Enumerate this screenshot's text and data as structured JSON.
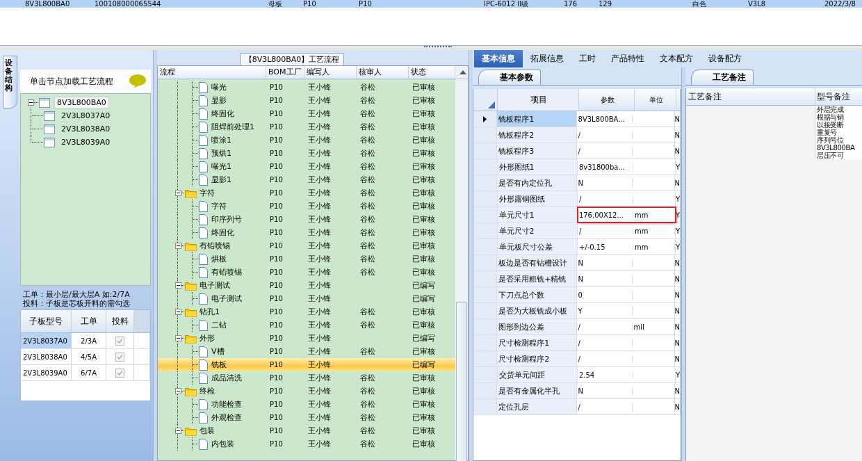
{
  "top_grid": {
    "row": {
      "selected": true,
      "cells": [
        "8V3L800BA0",
        "100108000065544",
        "母板",
        "P10",
        "P10",
        "IPC-6012 II级",
        "176",
        "129",
        "白色",
        "V3L8",
        "2022/3/8"
      ]
    }
  },
  "left_panel": {
    "side_tab": "设备结构",
    "hint": "单击节点加载工艺流程",
    "tree": {
      "label": "8V3L800BA0",
      "expanded": true,
      "selected": true,
      "children": [
        {
          "label": "2V3L8037A0",
          "selected": false
        },
        {
          "label": "2V3L8038A0",
          "selected": false
        },
        {
          "label": "2V3L8039A0",
          "selected": false
        }
      ]
    },
    "notes": [
      "工单：最小层/最大层A 如:2/7A",
      "投料：子板是芯板开料的需勾选"
    ],
    "grid": {
      "columns": [
        "子板型号",
        "工单",
        "投料"
      ],
      "rows": [
        {
          "model": "2V3L8037A0",
          "order": "2/3A",
          "feed": true,
          "selected": true
        },
        {
          "model": "2V3L8038A0",
          "order": "4/5A",
          "feed": true,
          "selected": false
        },
        {
          "model": "2V3L8039A0",
          "order": "6/7A",
          "feed": true,
          "selected": false
        }
      ]
    }
  },
  "process_panel": {
    "title": "【8V3L800BA0】工艺流程",
    "columns": [
      "流程",
      "BOM工厂",
      "编写人",
      "核审人",
      "状态"
    ],
    "scrolled_group_children": [
      {
        "label": "曝光",
        "factory": "P10",
        "writer": "王小锋",
        "reviewer": "谷松",
        "status": "已审核",
        "selected": false
      },
      {
        "label": "显影",
        "factory": "P10",
        "writer": "王小锋",
        "reviewer": "谷松",
        "status": "已审核",
        "selected": false
      },
      {
        "label": "终固化",
        "factory": "P10",
        "writer": "王小锋",
        "reviewer": "谷松",
        "status": "已审核",
        "selected": false
      },
      {
        "label": "阻焊前处理1",
        "factory": "P10",
        "writer": "王小锋",
        "reviewer": "谷松",
        "status": "已审核",
        "selected": false
      },
      {
        "label": "喷涂1",
        "factory": "P10",
        "writer": "王小锋",
        "reviewer": "谷松",
        "status": "已审核",
        "selected": false
      },
      {
        "label": "预烘1",
        "factory": "P10",
        "writer": "王小锋",
        "reviewer": "谷松",
        "status": "已审核",
        "selected": false
      },
      {
        "label": "曝光1",
        "factory": "P10",
        "writer": "王小锋",
        "reviewer": "谷松",
        "status": "已审核",
        "selected": false
      },
      {
        "label": "显影1",
        "factory": "P10",
        "writer": "王小锋",
        "reviewer": "谷松",
        "status": "已审核",
        "selected": false
      }
    ],
    "groups": [
      {
        "label": "字符",
        "factory": "P10",
        "writer": "王小锋",
        "reviewer": "谷松",
        "status": "已审核",
        "expanded": true,
        "children": [
          {
            "label": "字符",
            "factory": "P10",
            "writer": "王小锋",
            "reviewer": "谷松",
            "status": "已审核",
            "selected": false
          },
          {
            "label": "印序列号",
            "factory": "P10",
            "writer": "王小锋",
            "reviewer": "谷松",
            "status": "已审核",
            "selected": false
          },
          {
            "label": "终固化",
            "factory": "P10",
            "writer": "王小锋",
            "reviewer": "谷松",
            "status": "已审核",
            "selected": false
          }
        ]
      },
      {
        "label": "有铅喷锡",
        "factory": "P10",
        "writer": "王小锋",
        "reviewer": "谷松",
        "status": "已审核",
        "expanded": true,
        "children": [
          {
            "label": "烘板",
            "factory": "P10",
            "writer": "王小锋",
            "reviewer": "谷松",
            "status": "已审核",
            "selected": false
          },
          {
            "label": "有铅喷锡",
            "factory": "P10",
            "writer": "王小锋",
            "reviewer": "谷松",
            "status": "已审核",
            "selected": false
          }
        ]
      },
      {
        "label": "电子测试",
        "factory": "P10",
        "writer": "王小锋",
        "status": "已编写",
        "expanded": true,
        "children": [
          {
            "label": "电子测试",
            "factory": "P10",
            "writer": "王小锋",
            "status": "已编写",
            "selected": false
          }
        ]
      },
      {
        "label": "钻孔1",
        "factory": "P10",
        "writer": "王小锋",
        "reviewer": "谷松",
        "status": "已审核",
        "expanded": true,
        "children": [
          {
            "label": "二钻",
            "factory": "P10",
            "writer": "王小锋",
            "reviewer": "谷松",
            "status": "已审核",
            "selected": false
          }
        ]
      },
      {
        "label": "外形",
        "factory": "P10",
        "writer": "王小锋",
        "status": "已编写",
        "expanded": true,
        "children": [
          {
            "label": "V槽",
            "factory": "P10",
            "writer": "王小锋",
            "reviewer": "谷松",
            "status": "已审核",
            "selected": false
          },
          {
            "label": "铣板",
            "factory": "P10",
            "writer": "王小锋",
            "status": "已编写",
            "selected": true
          },
          {
            "label": "成品清洗",
            "factory": "P10",
            "writer": "王小锋",
            "reviewer": "谷松",
            "status": "已审核",
            "selected": false
          }
        ]
      },
      {
        "label": "终检",
        "factory": "P10",
        "writer": "王小锋",
        "reviewer": "谷松",
        "status": "已审核",
        "expanded": true,
        "children": [
          {
            "label": "功能检查",
            "factory": "P10",
            "writer": "王小锋",
            "reviewer": "谷松",
            "status": "已审核",
            "selected": false
          },
          {
            "label": "外观检查",
            "factory": "P10",
            "writer": "王小锋",
            "reviewer": "谷松",
            "status": "已审核",
            "selected": false
          }
        ]
      },
      {
        "label": "包装",
        "factory": "P10",
        "writer": "王小锋",
        "reviewer": "谷松",
        "status": "已审核",
        "expanded": true,
        "children": [
          {
            "label": "内包装",
            "factory": "P10",
            "writer": "王小锋",
            "reviewer": "谷松",
            "status": "已审核",
            "selected": false
          }
        ]
      }
    ]
  },
  "detail_panel": {
    "tabs": [
      {
        "label": "基本信息",
        "selected": true
      },
      {
        "label": "拓展信息",
        "selected": false
      },
      {
        "label": "工时",
        "selected": false
      },
      {
        "label": "产品特性",
        "selected": false
      },
      {
        "label": "文本配方",
        "selected": false
      },
      {
        "label": "设备配方",
        "selected": false
      }
    ],
    "sub_tab": "基本参数",
    "columns": [
      "项目",
      "参数",
      "单位"
    ],
    "rows": [
      {
        "item": "铣板程序1",
        "value": "8V3L800BA...",
        "column_4": "N",
        "selected": true,
        "marked": false
      },
      {
        "item": "铣板程序2",
        "value": "/",
        "column_4": "N",
        "selected": false,
        "marked": false
      },
      {
        "item": "铣板程序3",
        "value": "/",
        "column_4": "N",
        "selected": false,
        "marked": false
      },
      {
        "item": "外形图纸1",
        "value": "8v31800ba...",
        "column_4": "Y",
        "selected": false,
        "marked": false
      },
      {
        "item": "是否有内定位孔",
        "value": "N",
        "column_4": "N",
        "selected": false,
        "marked": false
      },
      {
        "item": "外形露铜图纸",
        "value": "/",
        "column_4": "Y",
        "selected": false,
        "marked": false
      },
      {
        "item": "单元尺寸1",
        "value": "176.00X12...",
        "unit": "mm",
        "column_4": "Y",
        "selected": false,
        "marked": true
      },
      {
        "item": "单元尺寸2",
        "value": "/",
        "unit": "mm",
        "column_4": "Y",
        "selected": false,
        "marked": false
      },
      {
        "item": "单元板尺寸公差",
        "value": "+/-0.15",
        "unit": "mm",
        "column_4": "Y",
        "selected": false,
        "marked": false
      },
      {
        "item": "板边是否有钻槽设计",
        "value": "N",
        "column_4": "N",
        "selected": false,
        "marked": false
      },
      {
        "item": "是否采用粗铣+精铣",
        "value": "N",
        "column_4": "N",
        "selected": false,
        "marked": false
      },
      {
        "item": "下刀点总个数",
        "value": "0",
        "column_4": "N",
        "selected": false,
        "marked": false
      },
      {
        "item": "是否为大板铣成小板",
        "value": "Y",
        "column_4": "N",
        "selected": false,
        "marked": false
      },
      {
        "item": "图形到边公差",
        "value": "/",
        "unit": "mil",
        "column_4": "N",
        "selected": false,
        "marked": false
      },
      {
        "item": "尺寸检测程序1",
        "value": "/",
        "column_4": "N",
        "selected": false,
        "marked": false
      },
      {
        "item": "尺寸检测程序2",
        "value": "/",
        "column_4": "N",
        "selected": false,
        "marked": false
      },
      {
        "item": "交货单元间距",
        "value": "2.54",
        "column_4": "Y",
        "selected": false,
        "marked": false
      },
      {
        "item": "是否有金属化半孔",
        "value": "N",
        "column_4": "N",
        "selected": false,
        "marked": false
      },
      {
        "item": "定位孔层",
        "value": "/",
        "column_4": "N",
        "selected": false,
        "marked": false
      }
    ]
  },
  "remarks_panel": {
    "sub_tab": "工艺备注",
    "columns": [
      "工艺备注",
      "型号备注"
    ],
    "model_remarks": [
      "外层完成",
      "根据与销",
      "以接受断",
      "重复号",
      "序列号位",
      "8V3L800BA",
      "层压不可"
    ]
  }
}
